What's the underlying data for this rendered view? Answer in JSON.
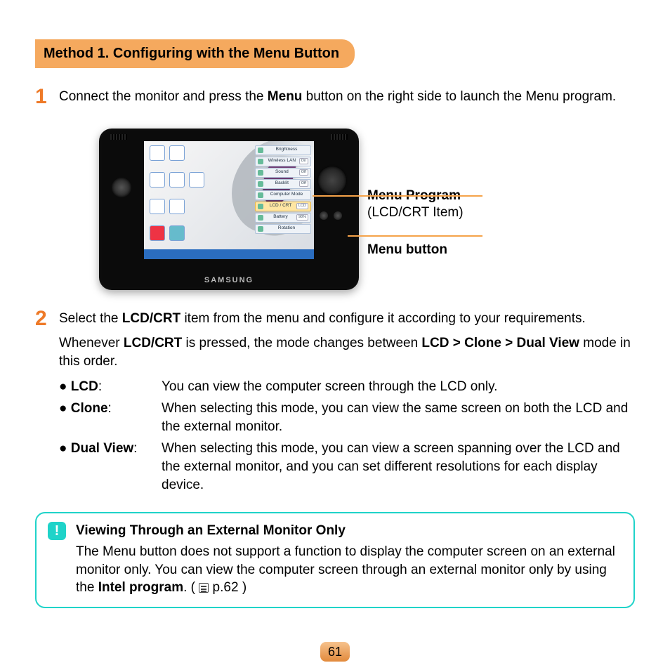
{
  "heading": "Method 1. Configuring with the Menu Button",
  "step1": {
    "pre": "Connect the monitor and press the ",
    "bold": "Menu",
    "post": " button on the right side to launch the Menu program."
  },
  "device": {
    "brand": "SAMSUNG",
    "menu_items": {
      "r1": "Brightness",
      "r2": "Wireless LAN",
      "r3": "Sound",
      "r4": "Backlit",
      "r5": "Computer Mode",
      "r6": "LCD / CRT",
      "r6_val": "LCD",
      "r7": "Battery",
      "r7_val": "98%",
      "r8": "Rotation",
      "on": "On",
      "off": "Off"
    }
  },
  "callouts": {
    "program": "Menu Program",
    "program_sub": "(LCD/CRT Item)",
    "button": "Menu button"
  },
  "step2": {
    "p1_a": "Select the ",
    "p1_b": "LCD/CRT",
    "p1_c": " item from the menu and configure it according to your requirements.",
    "p2_a": "Whenever ",
    "p2_b": "LCD/CRT",
    "p2_c": " is pressed, the mode changes between ",
    "p2_d": "LCD > Clone > Dual View",
    "p2_e": " mode in this order."
  },
  "modes": {
    "lcd_label": "LCD",
    "lcd_desc": "You can view the computer screen through the LCD only.",
    "clone_label": "Clone",
    "clone_desc": "When selecting this mode, you can view the same screen on both the LCD and the external monitor.",
    "dual_label": "Dual View",
    "dual_desc": "When selecting this mode, you can view a screen spanning over the LCD and the external monitor, and you can set different resolutions for each display device."
  },
  "note": {
    "icon": "!",
    "title": "Viewing Through an External Monitor Only",
    "body_a": "The Menu button does not support a function to display the computer screen on an external monitor only. You can view the computer screen through an external monitor only by using the ",
    "body_b": "Intel program",
    "body_c": ". ( ",
    "body_d": " p.62 )"
  },
  "page": "61"
}
